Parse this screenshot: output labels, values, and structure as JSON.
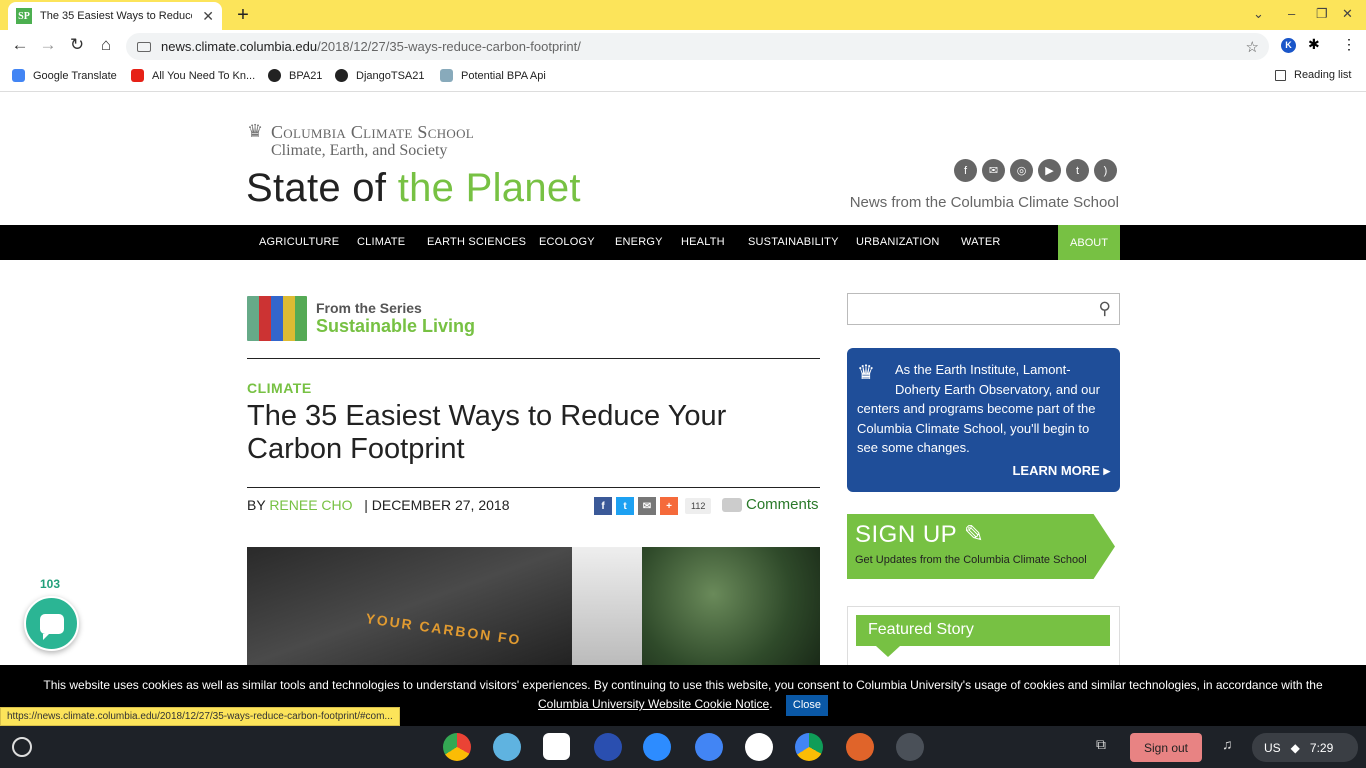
{
  "browser": {
    "tab_title": "The 35 Easiest Ways to Reduce",
    "favicon_text": "SP",
    "url_host": "news.climate.columbia.edu",
    "url_path": "/2018/12/27/35-ways-reduce-carbon-footprint/",
    "bookmarks": [
      "Google Translate",
      "All You Need To Kn...",
      "BPA21",
      "DjangoTSA21",
      "Potential BPA Api"
    ],
    "reading_list": "Reading list",
    "status_url": "https://news.climate.columbia.edu/2018/12/27/35-ways-reduce-carbon-footprint/#com..."
  },
  "site": {
    "logo_line1": "Columbia Climate School",
    "logo_line2": "Climate, Earth, and Society",
    "brand_a": "State of ",
    "brand_b": "the Planet",
    "tagline": "News from the Columbia Climate School",
    "nav": [
      "AGRICULTURE",
      "CLIMATE",
      "EARTH SCIENCES",
      "ECOLOGY",
      "ENERGY",
      "HEALTH",
      "SUSTAINABILITY",
      "URBANIZATION",
      "WATER"
    ],
    "nav_about": "ABOUT"
  },
  "article": {
    "series_label": "From the Series",
    "series_name": "Sustainable Living",
    "category": "CLIMATE",
    "title": "The 35 Easiest Ways to Reduce Your Carbon Footprint",
    "by": "BY ",
    "author": "RENEE CHO",
    "date": "| DECEMBER 27, 2018",
    "share_count": "112",
    "comments": "Comments",
    "hero_text": "YOUR CARBON FO"
  },
  "sidebar": {
    "promo_text": "As the Earth Institute, Lamont-Doherty Earth Observatory, and our centers and programs become part of the Columbia Climate School, you'll begin to see some changes.",
    "learn_more": "LEARN MORE",
    "signup_big": "SIGN UP",
    "signup_small": "Get Updates from the Columbia Climate School",
    "featured": "Featured Story"
  },
  "chat": {
    "count": "103"
  },
  "cookie": {
    "text": "This website uses cookies as well as similar tools and technologies to understand visitors' experiences. By continuing to use this website, you consent to Columbia University's usage of cookies and similar technologies, in accordance with the",
    "link": "Columbia University Website Cookie Notice",
    "period": ".",
    "close": "Close"
  },
  "shelf": {
    "sign_out": "Sign out",
    "locale": "US",
    "time": "7:29"
  }
}
